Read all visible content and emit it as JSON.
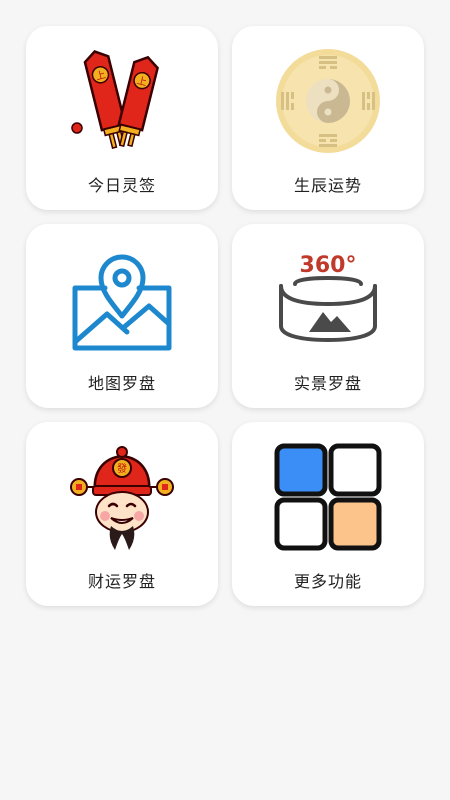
{
  "menu": {
    "items": [
      {
        "label": "今日灵签",
        "icon": "fortune-sticks-icon"
      },
      {
        "label": "生辰运势",
        "icon": "bagua-taiji-icon"
      },
      {
        "label": "地图罗盘",
        "icon": "map-pin-icon"
      },
      {
        "label": "实景罗盘",
        "icon": "panorama-360-icon",
        "icon_text": "360°"
      },
      {
        "label": "财运罗盘",
        "icon": "god-of-wealth-icon",
        "icon_text": "發"
      },
      {
        "label": "更多功能",
        "icon": "more-grid-icon"
      }
    ]
  },
  "colors": {
    "background": "#f6f6f6",
    "card": "#ffffff",
    "map_blue": "#1e88cf",
    "panorama_red": "#c0392b",
    "grid_blue": "#3a8ef6",
    "grid_orange": "#fcc48a",
    "sticks_red": "#e0251b",
    "sticks_gold": "#f2b01e"
  }
}
